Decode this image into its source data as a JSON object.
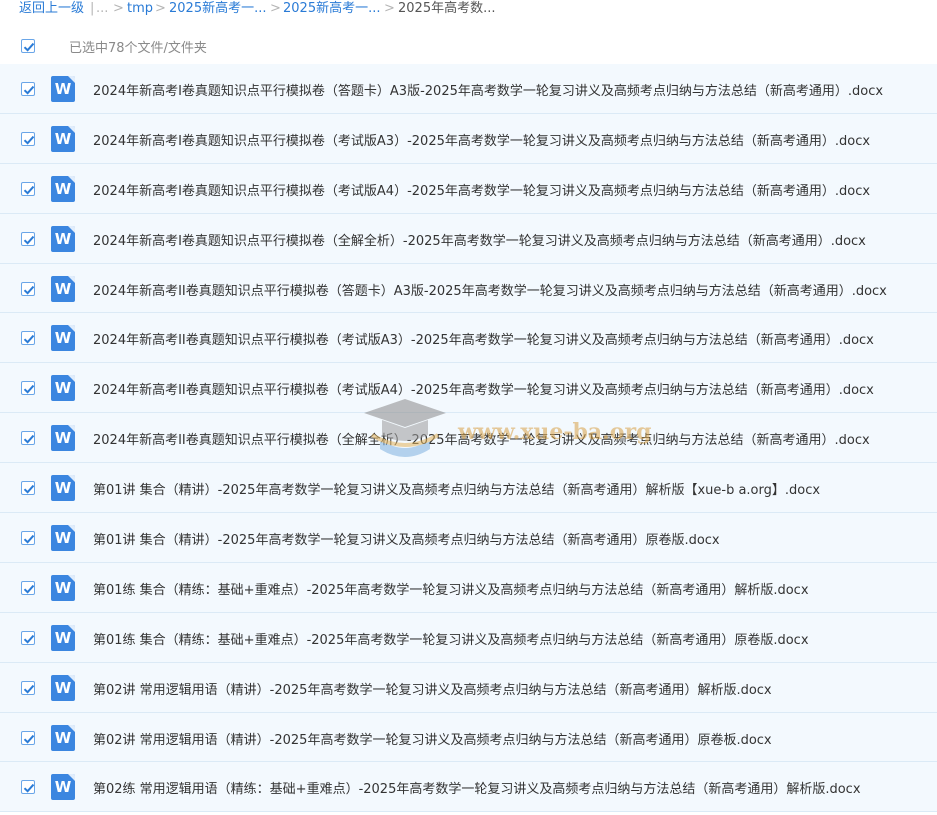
{
  "breadcrumb": {
    "back": "返回上一级",
    "sep_main": "|",
    "ellipsis": "...",
    "arrow": ">",
    "items": [
      "tmp",
      "2025新高考一...",
      "2025新高考一...",
      "2025年高考数..."
    ]
  },
  "selection": {
    "text": "已选中78个文件/文件夹",
    "checked": true
  },
  "files": [
    {
      "name": "2024年新高考I卷真题知识点平行模拟卷（答题卡）A3版-2025年高考数学一轮复习讲义及高频考点归纳与方法总结（新高考通用）.docx",
      "checked": true
    },
    {
      "name": "2024年新高考I卷真题知识点平行模拟卷（考试版A3）-2025年高考数学一轮复习讲义及高频考点归纳与方法总结（新高考通用）.docx",
      "checked": true
    },
    {
      "name": "2024年新高考I卷真题知识点平行模拟卷（考试版A4）-2025年高考数学一轮复习讲义及高频考点归纳与方法总结（新高考通用）.docx",
      "checked": true
    },
    {
      "name": "2024年新高考I卷真题知识点平行模拟卷（全解全析）-2025年高考数学一轮复习讲义及高频考点归纳与方法总结（新高考通用）.docx",
      "checked": true
    },
    {
      "name": "2024年新高考II卷真题知识点平行模拟卷（答题卡）A3版-2025年高考数学一轮复习讲义及高频考点归纳与方法总结（新高考通用）.docx",
      "checked": true
    },
    {
      "name": "2024年新高考II卷真题知识点平行模拟卷（考试版A3）-2025年高考数学一轮复习讲义及高频考点归纳与方法总结（新高考通用）.docx",
      "checked": true
    },
    {
      "name": "2024年新高考II卷真题知识点平行模拟卷（考试版A4）-2025年高考数学一轮复习讲义及高频考点归纳与方法总结（新高考通用）.docx",
      "checked": true
    },
    {
      "name": "2024年新高考II卷真题知识点平行模拟卷（全解全析）-2025年高考数学一轮复习讲义及高频考点归纳与方法总结（新高考通用）.docx",
      "checked": true
    },
    {
      "name": "第01讲 集合（精讲）-2025年高考数学一轮复习讲义及高频考点归纳与方法总结（新高考通用）解析版【xue-b a.org】.docx",
      "checked": true
    },
    {
      "name": "第01讲 集合（精讲）-2025年高考数学一轮复习讲义及高频考点归纳与方法总结（新高考通用）原卷版.docx",
      "checked": true
    },
    {
      "name": "第01练 集合（精练：基础+重难点）-2025年高考数学一轮复习讲义及高频考点归纳与方法总结（新高考通用）解析版.docx",
      "checked": true
    },
    {
      "name": "第01练 集合（精练：基础+重难点）-2025年高考数学一轮复习讲义及高频考点归纳与方法总结（新高考通用）原卷版.docx",
      "checked": true
    },
    {
      "name": "第02讲 常用逻辑用语（精讲）-2025年高考数学一轮复习讲义及高频考点归纳与方法总结（新高考通用）解析版.docx",
      "checked": true
    },
    {
      "name": "第02讲 常用逻辑用语（精讲）-2025年高考数学一轮复习讲义及高频考点归纳与方法总结（新高考通用）原卷板.docx",
      "checked": true
    },
    {
      "name": "第02练 常用逻辑用语（精练：基础+重难点）-2025年高考数学一轮复习讲义及高频考点归纳与方法总结（新高考通用）解析版.docx",
      "checked": true
    }
  ],
  "file_icon": {
    "name": "word-doc-icon",
    "letter": "W",
    "color": "#3b86e0"
  },
  "watermark": {
    "text": "www.xue-ba.org",
    "name": "graduation-cap-logo"
  },
  "colors": {
    "accent": "#2a7bd6",
    "row_bg": "#f3f9fe",
    "row_border": "#dbeaf6"
  }
}
